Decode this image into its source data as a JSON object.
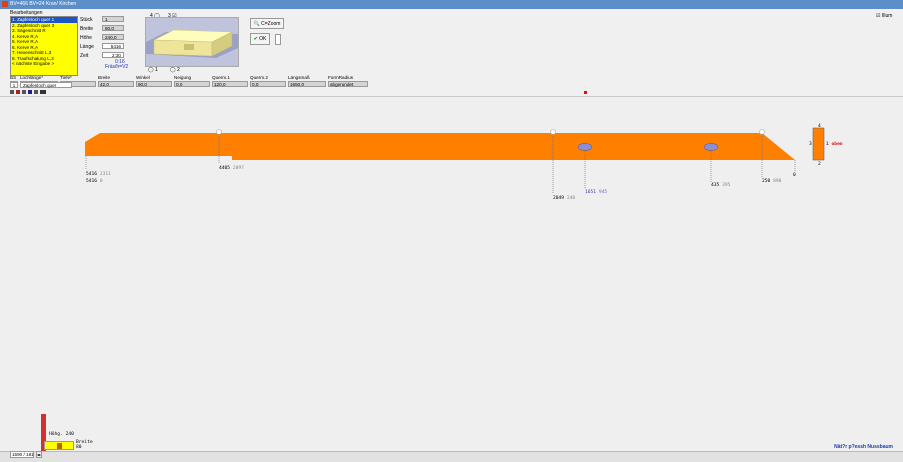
{
  "window": {
    "title": "BV=466 BV=24 Kran/ Kirchen"
  },
  "left_panel": {
    "list_label": "Bearbeitungen",
    "items": [
      "1. Zapfenloch quer 1",
      "2. Zapfenloch quer 3",
      "3. Sägeschnitt R",
      "4. Kerve R,A",
      "5. Kerve R,A",
      "6. Kerve R,A",
      "7. Hexenschnitt L,3",
      "8. Traufschalung L,3",
      "< nächste Eingabe >"
    ],
    "selected_index": 0
  },
  "fields": {
    "stueck_label": "Stück",
    "stueck_value": "1",
    "breite_label": "Breite",
    "breite_value": "80,0",
    "hoehe_label": "Höhe",
    "hoehe_value": "240,0",
    "laenge_label": "Länge",
    "laenge_value": "5416",
    "zeit_label": "Zeit",
    "zeit_value": "2:30",
    "extra_value": "0:16",
    "extra2_value": "Fräs/h=V2"
  },
  "preview": {
    "radio_top_left": "4",
    "radio_top_right": "3",
    "radio_bottom_1": "1",
    "radio_bottom_2": "2"
  },
  "buttons": {
    "zoom_label": "C=Zoom",
    "ok_label": "OK"
  },
  "param_row": {
    "bs_label": "BS",
    "bs_value": "3",
    "headers": [
      "Lochlänge*",
      "Tiefe*",
      "Breite",
      "Winkel",
      "Neigung",
      "Querm.1",
      "Querm.2",
      "Längsmaß",
      "FormRadius"
    ],
    "values": [
      "80,0",
      "40,0",
      "42,0",
      "90,0",
      "0,0",
      "120,0",
      "0,0",
      "1650,0",
      "abgerundet"
    ]
  },
  "current_operation": {
    "index": "1",
    "name": "Zapfenloch quer"
  },
  "top_right_check": "Illum",
  "dimensions": {
    "left_total": "5416",
    "left_total_sub": "2311",
    "left_total2": "5416",
    "left_total2_sub": "0",
    "mark1": "4405",
    "mark1_sub": "2097",
    "mark2": "2049",
    "mark2_sub": "240",
    "mark3": "1651",
    "mark3_sub": "945",
    "mark4": "435",
    "mark4_sub": "395",
    "mark5": "250",
    "mark5_sub": "890",
    "right_end": "0"
  },
  "cross_section": {
    "top_label": "4",
    "left_label": "3",
    "right_label": "1 oben",
    "bottom_label": "2"
  },
  "mini_preview": {
    "hoehe_text": "Höhg. 240",
    "breite_text": "Breite",
    "breite_value": "80"
  },
  "footer": {
    "zoom_value": "1590 / 181",
    "brand_text": "Nät?r p?essh Nussbaum"
  },
  "colors": {
    "beam": "#ff7f00",
    "list_bg": "#ffff00",
    "selection": "#1d56c4",
    "hole": "#8a8fd6",
    "title_bar": "#5c8fc9"
  }
}
